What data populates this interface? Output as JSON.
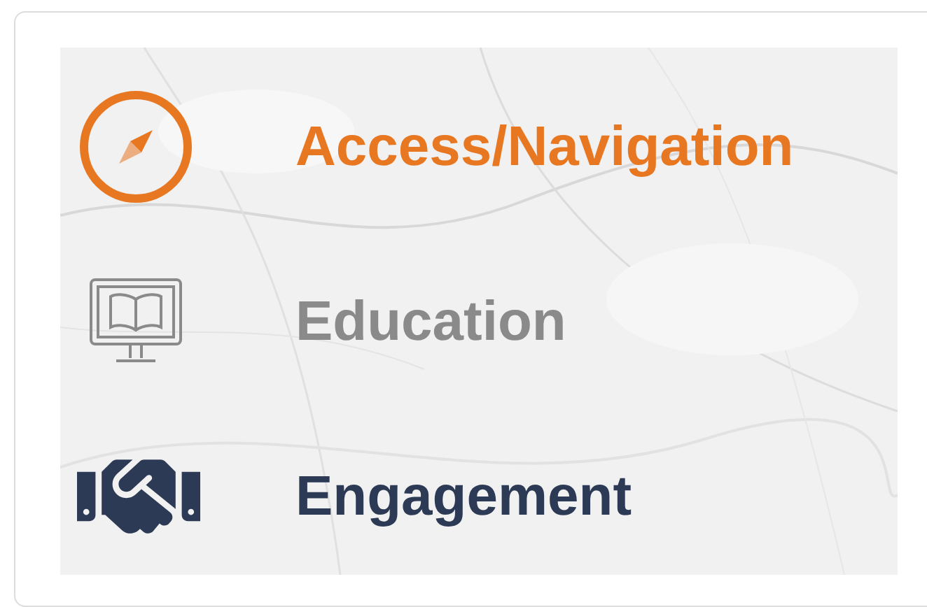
{
  "items": [
    {
      "kind": "compass",
      "label": "Access/Navigation",
      "color": "#e87722"
    },
    {
      "kind": "monitor",
      "label": "Education",
      "color": "#8a8a8a"
    },
    {
      "kind": "handshake",
      "label": "Engagement",
      "color": "#2c3a55"
    }
  ]
}
